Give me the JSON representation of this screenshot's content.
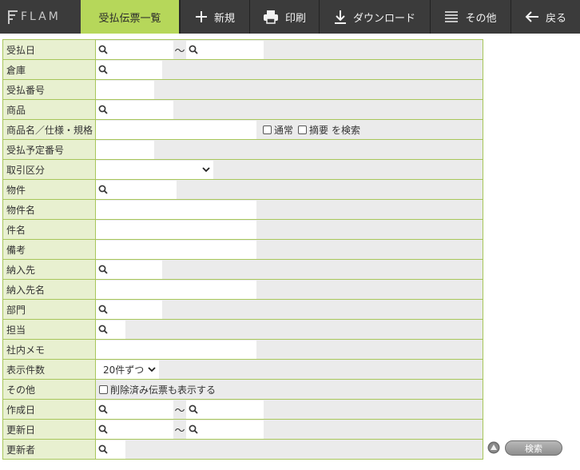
{
  "app": {
    "logo_text": "FLAM"
  },
  "toolbar": {
    "active_tab": "受払伝票一覧",
    "new_label": "新規",
    "print_label": "印刷",
    "download_label": "ダウンロード",
    "other_label": "その他",
    "back_label": "戻る"
  },
  "form": {
    "tilde": "〜",
    "rows": [
      "受払日",
      "倉庫",
      "受払番号",
      "商品",
      "商品名／仕様・規格",
      "受払予定番号",
      "取引区分",
      "物件",
      "物件名",
      "件名",
      "備考",
      "納入先",
      "納入先名",
      "部門",
      "担当",
      "社内メモ",
      "表示件数",
      "その他",
      "作成日",
      "更新日",
      "更新者"
    ],
    "product_name_options": {
      "normal": "通常",
      "summary": "摘要",
      "suffix": "を検索"
    },
    "display_count": "20件ずつ",
    "other_option": "削除済み伝票も表示する"
  },
  "search": {
    "label": "検索"
  },
  "colors": {
    "accent": "#b6d75a",
    "toolbar": "#3b3b3b",
    "border": "#a7c65a",
    "label_bg": "#e8f0d0"
  }
}
